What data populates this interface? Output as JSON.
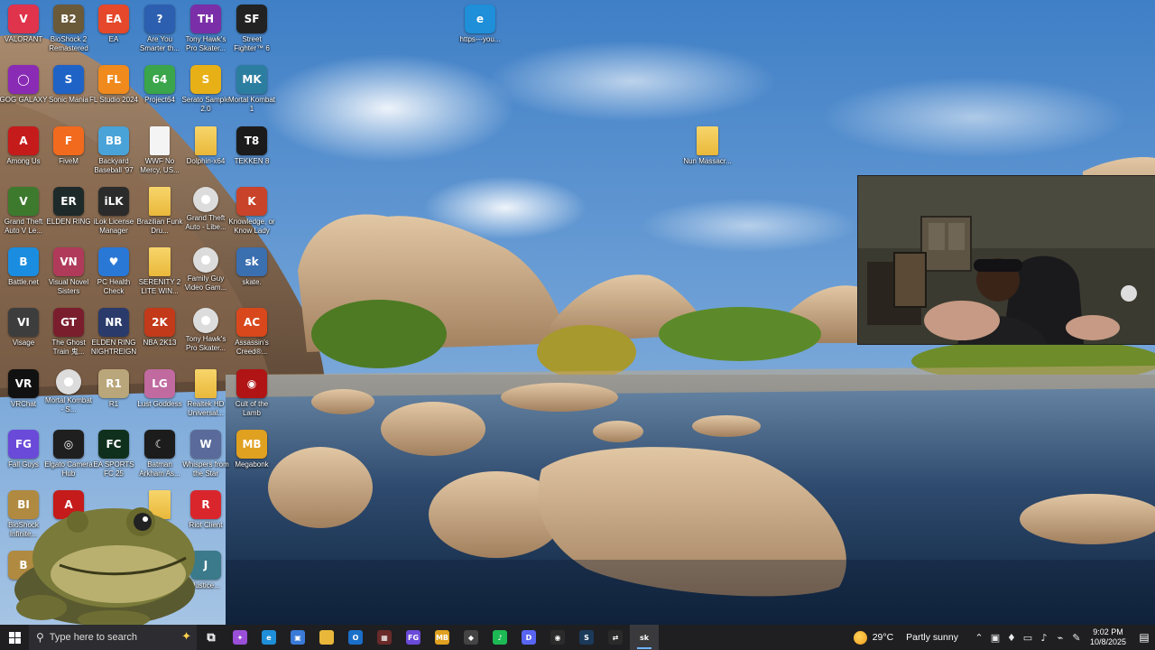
{
  "desktop": {
    "icons": [
      {
        "label": "VALORANT",
        "glyph": "V",
        "color": "#e0334c"
      },
      {
        "label": "BioShock 2 Remastered",
        "glyph": "B2",
        "color": "#6a5a3a"
      },
      {
        "label": "EA",
        "glyph": "EA",
        "color": "#e5482a"
      },
      {
        "label": "Are You Smarter th...",
        "glyph": "?",
        "color": "#2d5fb0"
      },
      {
        "label": "Tony Hawk's Pro Skater...",
        "glyph": "TH",
        "color": "#7a2fa8"
      },
      {
        "label": "Street Fighter™ 6",
        "glyph": "SF",
        "color": "#222222"
      },
      {
        "label": "GOG GALAXY",
        "glyph": "◯",
        "color": "#8a2bb5"
      },
      {
        "label": "Sonic Mania",
        "glyph": "S",
        "color": "#1f63c6"
      },
      {
        "label": "FL Studio 2024",
        "glyph": "FL",
        "color": "#f08a1c"
      },
      {
        "label": "Project64",
        "glyph": "64",
        "color": "#3aa54a"
      },
      {
        "label": "Serato Sample 2.0",
        "glyph": "S",
        "color": "#e8b017"
      },
      {
        "label": "Mortal Kombat 1",
        "glyph": "MK",
        "color": "#2c7ea0"
      },
      {
        "label": "Among Us",
        "glyph": "A",
        "color": "#c51b1b"
      },
      {
        "label": "FiveM",
        "glyph": "F",
        "color": "#f26a1d"
      },
      {
        "label": "Backyard Baseball '97",
        "glyph": "BB",
        "color": "#4aa3d8"
      },
      {
        "label": "WWF No Mercy, US...",
        "glyph": "",
        "color": "#f4f4f4",
        "kind": "doc"
      },
      {
        "label": "Dolphin-x64",
        "glyph": "",
        "color": "#e9b83a",
        "kind": "folder"
      },
      {
        "label": "TEKKEN 8",
        "glyph": "T8",
        "color": "#1b1b1b"
      },
      {
        "label": "Grand Theft Auto V Le...",
        "glyph": "V",
        "color": "#3d7a2e"
      },
      {
        "label": "ELDEN RING",
        "glyph": "ER",
        "color": "#1e2a2a"
      },
      {
        "label": "iLok License Manager",
        "glyph": "iLK",
        "color": "#2b2b2b"
      },
      {
        "label": "Brazilian Funk Dru...",
        "glyph": "",
        "color": "#e9b83a",
        "kind": "folder"
      },
      {
        "label": "Grand Theft Auto - Libe...",
        "glyph": "",
        "color": "#dcdcdc",
        "kind": "disc"
      },
      {
        "label": "Knowledge, or Know Lady",
        "glyph": "K",
        "color": "#c8432a"
      },
      {
        "label": "Battle.net",
        "glyph": "B",
        "color": "#1a8de0"
      },
      {
        "label": "Visual Novel Sisters",
        "glyph": "VN",
        "color": "#b03a5a"
      },
      {
        "label": "PC Health Check",
        "glyph": "♥",
        "color": "#2a78d6"
      },
      {
        "label": "SERENITY 2 LITE WIN...",
        "glyph": "",
        "color": "#e9b83a",
        "kind": "folder"
      },
      {
        "label": "Family Guy Video Gam...",
        "glyph": "",
        "color": "#dcdcdc",
        "kind": "disc"
      },
      {
        "label": "skate.",
        "glyph": "sk",
        "color": "#3a6fb0"
      },
      {
        "label": "Visage",
        "glyph": "VI",
        "color": "#3d3d3d"
      },
      {
        "label": "The Ghost Train 鬼...",
        "glyph": "GT",
        "color": "#7a1e2e"
      },
      {
        "label": "ELDEN RING NIGHTREIGN",
        "glyph": "NR",
        "color": "#2a3a6a"
      },
      {
        "label": "NBA 2K13",
        "glyph": "2K",
        "color": "#c23a1a"
      },
      {
        "label": "Tony Hawk's Pro Skater...",
        "glyph": "",
        "color": "#dcdcdc",
        "kind": "disc"
      },
      {
        "label": "Assassin's Creed®...",
        "glyph": "AC",
        "color": "#d8481c"
      },
      {
        "label": "VRChat",
        "glyph": "VR",
        "color": "#111111"
      },
      {
        "label": "Mortal Kombat - S...",
        "glyph": "",
        "color": "#dcdcdc",
        "kind": "disc"
      },
      {
        "label": "R1",
        "glyph": "R1",
        "color": "#b9a67a"
      },
      {
        "label": "Lust Goddess",
        "glyph": "LG",
        "color": "#c06aa0"
      },
      {
        "label": "Realtek HD Universal...",
        "glyph": "",
        "color": "#e9b83a",
        "kind": "folder"
      },
      {
        "label": "Cult of the Lamb",
        "glyph": "◉",
        "color": "#b01414"
      },
      {
        "label": "Fall Guys",
        "glyph": "FG",
        "color": "#6a4ad8"
      },
      {
        "label": "Elgato Camera Hub",
        "glyph": "◎",
        "color": "#1f1f1f"
      },
      {
        "label": "EA SPORTS FC 25",
        "glyph": "FC",
        "color": "#10301e"
      },
      {
        "label": "Batman Arkham As...",
        "glyph": "☾",
        "color": "#1c1c1c"
      },
      {
        "label": "Whispers from the Star",
        "glyph": "W",
        "color": "#5a6a9a"
      },
      {
        "label": "Megabonk",
        "glyph": "MB",
        "color": "#e0a020"
      },
      {
        "label": "BioShock Infinite...",
        "glyph": "BI",
        "color": "#b08a40"
      },
      {
        "label": "",
        "glyph": "A",
        "color": "#c51b1b"
      },
      {
        "label": "",
        "glyph": "",
        "color": "#e9b83a",
        "kind": "folder"
      },
      {
        "label": "Riot Client",
        "glyph": "R",
        "color": "#d8262c"
      },
      {
        "label": "Bi...",
        "glyph": "B",
        "color": "#b08a40"
      },
      {
        "label": "Justice...",
        "glyph": "J",
        "color": "#3a7a8a"
      },
      {
        "label": "https---you...",
        "glyph": "e",
        "color": "#1e8fd8"
      },
      {
        "label": "Nun Massacr...",
        "glyph": "",
        "color": "#e9b83a",
        "kind": "folder"
      }
    ]
  },
  "taskbar": {
    "search_placeholder": "Type here to search",
    "apps": [
      {
        "name": "task-view",
        "glyph": "⧉",
        "color": "transparent"
      },
      {
        "name": "copilot",
        "glyph": "✦",
        "color": "#9b4fd8"
      },
      {
        "name": "edge",
        "glyph": "e",
        "color": "#1e8fd8"
      },
      {
        "name": "store",
        "glyph": "▣",
        "color": "#3a7ad8"
      },
      {
        "name": "file-explorer",
        "glyph": "",
        "color": "#e9b83a"
      },
      {
        "name": "outlook",
        "glyph": "O",
        "color": "#1a6fc8"
      },
      {
        "name": "game-1",
        "glyph": "▦",
        "color": "#6a2a2a"
      },
      {
        "name": "fall-guys",
        "glyph": "FG",
        "color": "#6a4ad8"
      },
      {
        "name": "megabonk",
        "glyph": "MB",
        "color": "#e0a020"
      },
      {
        "name": "game-2",
        "glyph": "◆",
        "color": "#444444"
      },
      {
        "name": "spotify",
        "glyph": "♪",
        "color": "#1db954"
      },
      {
        "name": "discord",
        "glyph": "D",
        "color": "#5865f2"
      },
      {
        "name": "obs",
        "glyph": "◉",
        "color": "#2b2b2b"
      },
      {
        "name": "steam",
        "glyph": "S",
        "color": "#1b3a5a"
      },
      {
        "name": "streamlabs",
        "glyph": "⇄",
        "color": "#2a2a2a"
      },
      {
        "name": "skate-app",
        "glyph": "sk",
        "color": "#3a3a3a"
      }
    ],
    "weather": {
      "temp": "29°C",
      "condition": "Partly sunny"
    },
    "time": "9:02 PM",
    "date": "10/8/2025"
  }
}
